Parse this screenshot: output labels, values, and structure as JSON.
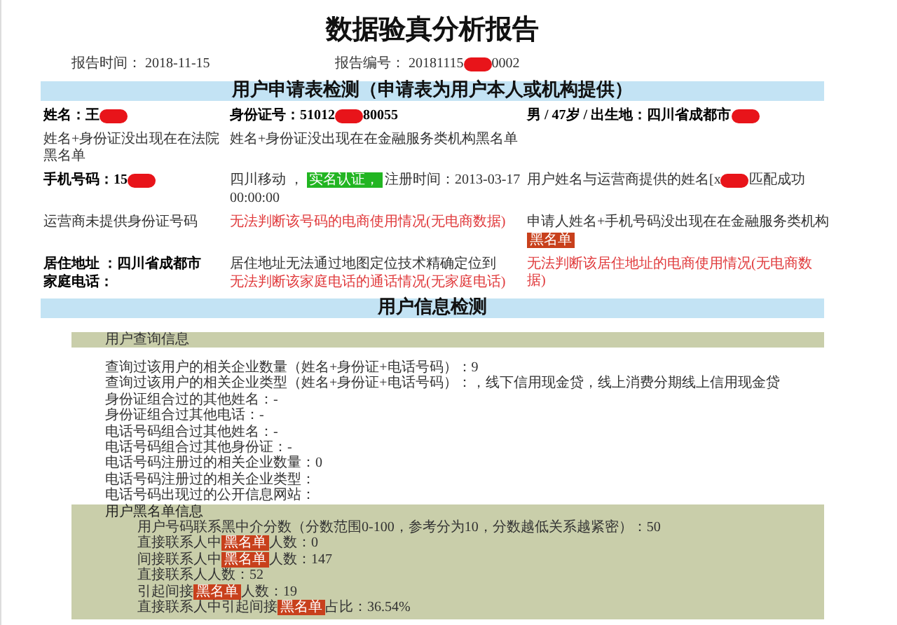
{
  "title": "数据验真分析报告",
  "meta": [
    {
      "label": "报告时间：",
      "value": "2018-11-15"
    },
    {
      "label": "报告编号：",
      "value": "20181115",
      "tail": "0002"
    }
  ],
  "applicant": {
    "heading": "用户申请表检测（申请表为用户本人或机构提供）",
    "rows": [
      [
        [
          [
            {
              "kind": "bold",
              "text": "姓名：王"
            },
            {
              "kind": "redacted"
            }
          ]
        ],
        [
          [
            {
              "kind": "bold",
              "text": "身份证号：51012"
            },
            {
              "kind": "redacted"
            },
            {
              "kind": "bold",
              "text": "80055"
            }
          ]
        ],
        [
          [
            {
              "kind": "bold",
              "text": "男 / 47岁 / 出生地：四川省成都市"
            },
            {
              "kind": "redacted"
            }
          ]
        ]
      ],
      [
        [
          [
            {
              "kind": "text",
              "text": "姓名+身份证没出现在在法院黑名单"
            }
          ]
        ],
        [
          [
            {
              "kind": "text",
              "text": "姓名+身份证没出现在在金融服务类机构黑名单"
            }
          ]
        ],
        []
      ],
      [
        [
          [
            {
              "kind": "bold",
              "text": "手机号码：15"
            },
            {
              "kind": "redacted"
            }
          ]
        ],
        [
          [
            {
              "kind": "text",
              "text": "四川移动 ，"
            },
            {
              "kind": "badge",
              "text": "实名认证，"
            },
            {
              "kind": "text",
              "text": "注册时间：2013-03-17"
            }
          ],
          [
            {
              "kind": "text",
              "text": "00:00:00"
            }
          ]
        ],
        [
          [
            {
              "kind": "text",
              "text": "用户姓名与运营商提供的姓名[x"
            },
            {
              "kind": "redacted"
            },
            {
              "kind": "text",
              "text": "匹配成功"
            }
          ]
        ]
      ],
      [
        [
          [
            {
              "kind": "text",
              "text": "运营商未提供身份证号码"
            }
          ]
        ],
        [
          [
            {
              "kind": "warn",
              "text": "无法判断该号码的电商使用情况(无电商数据)"
            }
          ]
        ],
        [
          [
            {
              "kind": "text",
              "text": "申请人姓名+手机号码没出现在在金融服务类机构"
            }
          ],
          [
            {
              "kind": "tag",
              "text": "黑名单"
            }
          ]
        ]
      ],
      [
        [
          [
            {
              "kind": "bold",
              "text": "居住地址 ：四川省成都市"
            }
          ],
          [
            {
              "kind": "bold",
              "text": "家庭电话："
            }
          ]
        ],
        [
          [
            {
              "kind": "text",
              "text": "居住地址无法通过地图定位技术精确定位到"
            }
          ],
          [
            {
              "kind": "warn",
              "text": "无法判断该家庭电话的通话情况(无家庭电话)"
            }
          ]
        ],
        [
          [
            {
              "kind": "warn",
              "text": "无法判断该居住地址的电商使用情况(无电商数据)"
            }
          ]
        ]
      ]
    ]
  },
  "user_info": {
    "heading": "用户信息检测",
    "query_heading": "用户查询信息",
    "query_lines": [
      [
        {
          "kind": "text",
          "text": "查询过该用户的相关企业数量（姓名+身份证+电话号码）：9"
        }
      ],
      [
        {
          "kind": "text",
          "text": "查询过该用户的相关企业类型（姓名+身份证+电话号码）：，线下信用现金贷，线上消费分期线上信用现金贷"
        }
      ],
      [
        {
          "kind": "text",
          "text": "身份证组合过的其他姓名：-"
        }
      ],
      [
        {
          "kind": "text",
          "text": "身份证组合过其他电话：-"
        }
      ],
      [
        {
          "kind": "text",
          "text": "电话号码组合过其他姓名：-"
        }
      ],
      [
        {
          "kind": "text",
          "text": "电话号码组合过其他身份证：-"
        }
      ],
      [
        {
          "kind": "text",
          "text": "电话号码注册过的相关企业数量：0"
        }
      ],
      [
        {
          "kind": "text",
          "text": "电话号码注册过的相关企业类型："
        }
      ],
      [
        {
          "kind": "text",
          "text": "电话号码出现过的公开信息网站："
        }
      ]
    ],
    "blacklist_heading": "用户黑名单信息",
    "blacklist_lines": [
      [
        {
          "kind": "text",
          "text": "用户号码联系黑中介分数（分数范围0-100，参考分为10，分数越低关系越紧密）：50"
        }
      ],
      [
        {
          "kind": "text",
          "text": "直接联系人中"
        },
        {
          "kind": "tag",
          "text": "黑名单"
        },
        {
          "kind": "text",
          "text": "人数：0"
        }
      ],
      [
        {
          "kind": "text",
          "text": "间接联系人中"
        },
        {
          "kind": "tag",
          "text": "黑名单"
        },
        {
          "kind": "text",
          "text": "人数：147"
        }
      ],
      [
        {
          "kind": "text",
          "text": "直接联系人人数：52"
        }
      ],
      [
        {
          "kind": "text",
          "text": "引起间接"
        },
        {
          "kind": "tag",
          "text": "黑名单"
        },
        {
          "kind": "text",
          "text": "人数：19"
        }
      ],
      [
        {
          "kind": "text",
          "text": "直接联系人中引起间接"
        },
        {
          "kind": "tag",
          "text": "黑名单"
        },
        {
          "kind": "text",
          "text": "占比：36.54%"
        }
      ]
    ]
  }
}
